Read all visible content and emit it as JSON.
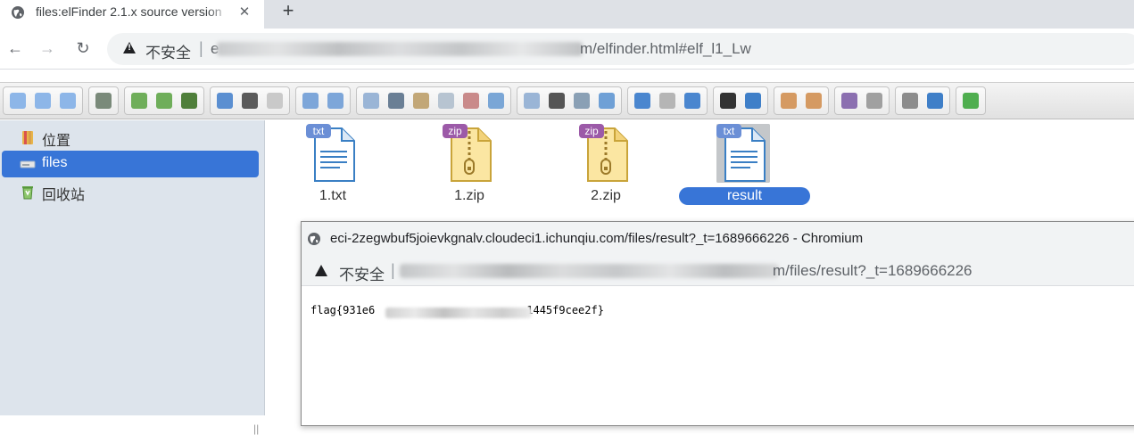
{
  "browser": {
    "tab_title": "files:elFinder 2.1.x source version",
    "tab_close": "✕",
    "new_tab": "+",
    "back": "←",
    "forward": "→",
    "reload": "↻",
    "insecure_label": "不安全",
    "separator": "|",
    "url_prefix": "e",
    "url_suffix": "m/elfinder.html#elf_l1_Lw"
  },
  "toolbar": {
    "groups": [
      {
        "buttons": [
          "back-icon",
          "forward-icon",
          "up-icon"
        ]
      },
      {
        "buttons": [
          "netmount-icon"
        ]
      },
      {
        "buttons": [
          "mkdir-icon",
          "mkfile-icon",
          "upload-icon"
        ]
      },
      {
        "buttons": [
          "open-icon",
          "download-icon",
          "getfile-icon"
        ]
      },
      {
        "buttons": [
          "undo-icon",
          "redo-icon"
        ]
      },
      {
        "buttons": [
          "copy-icon",
          "cut-icon",
          "paste-icon",
          "rm-icon",
          "empty-icon",
          "hide-icon"
        ]
      },
      {
        "buttons": [
          "duplicate-icon",
          "rename-icon",
          "edit-icon",
          "resize-icon"
        ]
      },
      {
        "buttons": [
          "view-icons-icon",
          "view-small-icon",
          "view-list-icon"
        ]
      },
      {
        "buttons": [
          "quicklook-icon",
          "info-icon"
        ]
      },
      {
        "buttons": [
          "extract-icon",
          "archive-icon"
        ]
      },
      {
        "buttons": [
          "sort-icon",
          "places-icon"
        ]
      },
      {
        "buttons": [
          "preference-icon",
          "help-icon"
        ]
      },
      {
        "buttons": [
          "fullscreen-icon"
        ]
      }
    ]
  },
  "sidebar": {
    "items": [
      {
        "label": "位置",
        "icon": "places-icon"
      },
      {
        "label": "files",
        "icon": "drive-icon"
      },
      {
        "label": "回收站",
        "icon": "trash-icon"
      }
    ],
    "splitter": "||"
  },
  "files": [
    {
      "name": "1.txt",
      "badge": "txt"
    },
    {
      "name": "1.zip",
      "badge": "zip"
    },
    {
      "name": "2.zip",
      "badge": "zip"
    },
    {
      "name": "result",
      "badge": "txt"
    }
  ],
  "popup": {
    "title": "eci-2zegwbuf5joievkgnalv.cloudeci1.ichunqiu.com/files/result?_t=1689666226 - Chromium",
    "insecure_label": "不安全",
    "separator": "|",
    "url_suffix": "m/files/result?_t=1689666226",
    "content_prefix": "flag{931e6",
    "content_suffix": "1445f9cee2f}"
  },
  "colors": {
    "selection": "#3875d7",
    "sidebar_bg": "#dde4ec",
    "txt_badge": "#6b8fd6",
    "zip_badge": "#9c5aa8"
  }
}
